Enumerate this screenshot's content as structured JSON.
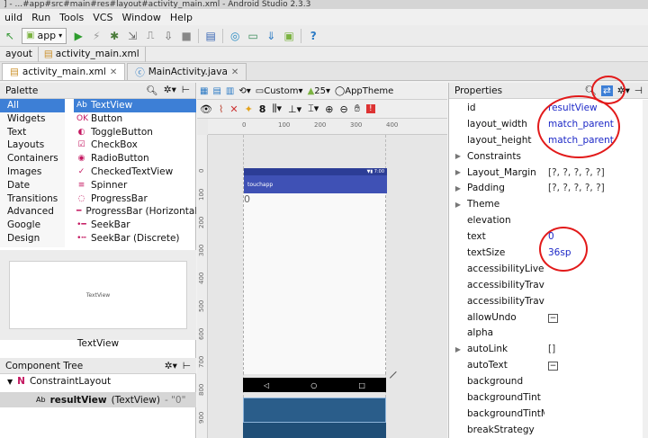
{
  "window": {
    "title": "] - ...#app#src#main#res#layout#activity_main.xml - Android Studio 2.3.3"
  },
  "menu": [
    "uild",
    "Run",
    "Tools",
    "VCS",
    "Window",
    "Help"
  ],
  "toolbar": {
    "run_config": "app",
    "help_label": "?"
  },
  "breadcrumbs": [
    "ayout",
    "activity_main.xml"
  ],
  "tabs": [
    {
      "label": "activity_main.xml",
      "active": true
    },
    {
      "label": "MainActivity.java",
      "active": false
    }
  ],
  "palette": {
    "title": "Palette",
    "categories": [
      "All",
      "Widgets",
      "Text",
      "Layouts",
      "Containers",
      "Images",
      "Date",
      "Transitions",
      "Advanced",
      "Google",
      "Design",
      "AppCompat"
    ],
    "widgets": [
      {
        "label": "TextView",
        "icon": "Ab"
      },
      {
        "label": "Button",
        "icon": "OK"
      },
      {
        "label": "ToggleButton",
        "icon": "◐"
      },
      {
        "label": "CheckBox",
        "icon": "☑"
      },
      {
        "label": "RadioButton",
        "icon": "◉"
      },
      {
        "label": "CheckedTextView",
        "icon": "✓"
      },
      {
        "label": "Spinner",
        "icon": "≡"
      },
      {
        "label": "ProgressBar",
        "icon": "◌"
      },
      {
        "label": "ProgressBar (Horizontal)",
        "icon": "━"
      },
      {
        "label": "SeekBar",
        "icon": "•━"
      },
      {
        "label": "SeekBar (Discrete)",
        "icon": "•┅"
      },
      {
        "label": "QuickContactBadge",
        "icon": "▣"
      }
    ],
    "preview_text": "TextView",
    "preview_label": "TextView"
  },
  "component_tree": {
    "title": "Component Tree",
    "root": "ConstraintLayout",
    "child": {
      "name": "resultView",
      "type": "(TextView)",
      "text": "- \"0\""
    }
  },
  "designer": {
    "toolbar1": {
      "device": "Custom",
      "api": "25",
      "theme": "AppTheme"
    },
    "toolbar2": {
      "margin": "8"
    },
    "ruler_h": [
      "0",
      "100",
      "200",
      "300",
      "400"
    ],
    "ruler_v": [
      "0",
      "100",
      "200",
      "300",
      "400",
      "500",
      "600",
      "700",
      "800",
      "900"
    ],
    "phone": {
      "status_time": "7:00",
      "app_title": "touchapp",
      "text": "0"
    }
  },
  "properties": {
    "title": "Properties",
    "rows": [
      {
        "name": "id",
        "value": "resultView",
        "expand": false,
        "style": "blue"
      },
      {
        "name": "layout_width",
        "value": "match_parent",
        "expand": false,
        "style": "blue"
      },
      {
        "name": "layout_height",
        "value": "match_parent",
        "expand": false,
        "style": "blue"
      },
      {
        "name": "Constraints",
        "value": "",
        "expand": true,
        "style": "gray"
      },
      {
        "name": "Layout_Margin",
        "value": "[?, ?, ?, ?, ?]",
        "expand": true,
        "style": "gray"
      },
      {
        "name": "Padding",
        "value": "[?, ?, ?, ?, ?]",
        "expand": true,
        "style": "gray"
      },
      {
        "name": "Theme",
        "value": "",
        "expand": true,
        "style": "gray"
      },
      {
        "name": "elevation",
        "value": "",
        "expand": false,
        "style": "gray"
      },
      {
        "name": "text",
        "value": "0",
        "expand": false,
        "style": "blue"
      },
      {
        "name": "textSize",
        "value": "36sp",
        "expand": false,
        "style": "blue"
      },
      {
        "name": "accessibilityLiveReg",
        "value": "",
        "expand": false,
        "style": "gray"
      },
      {
        "name": "accessibilityTravers",
        "value": "",
        "expand": false,
        "style": "gray"
      },
      {
        "name": "accessibilityTravers",
        "value": "",
        "expand": false,
        "style": "gray"
      },
      {
        "name": "allowUndo",
        "value": "−",
        "expand": false,
        "style": "check"
      },
      {
        "name": "alpha",
        "value": "",
        "expand": false,
        "style": "gray"
      },
      {
        "name": "autoLink",
        "value": "[]",
        "expand": true,
        "style": "gray"
      },
      {
        "name": "autoText",
        "value": "−",
        "expand": false,
        "style": "check"
      },
      {
        "name": "background",
        "value": "",
        "expand": false,
        "style": "gray"
      },
      {
        "name": "backgroundTint",
        "value": "",
        "expand": false,
        "style": "gray"
      },
      {
        "name": "backgroundTintMo",
        "value": "",
        "expand": false,
        "style": "gray"
      },
      {
        "name": "breakStrategy",
        "value": "",
        "expand": false,
        "style": "gray"
      }
    ]
  },
  "colors": {
    "selection": "#3d7fd6",
    "value_blue": "#1d28c7",
    "annotation_red": "#e21a1a",
    "app_bar": "#3f51b5",
    "blueprint": "#1f4e77"
  }
}
